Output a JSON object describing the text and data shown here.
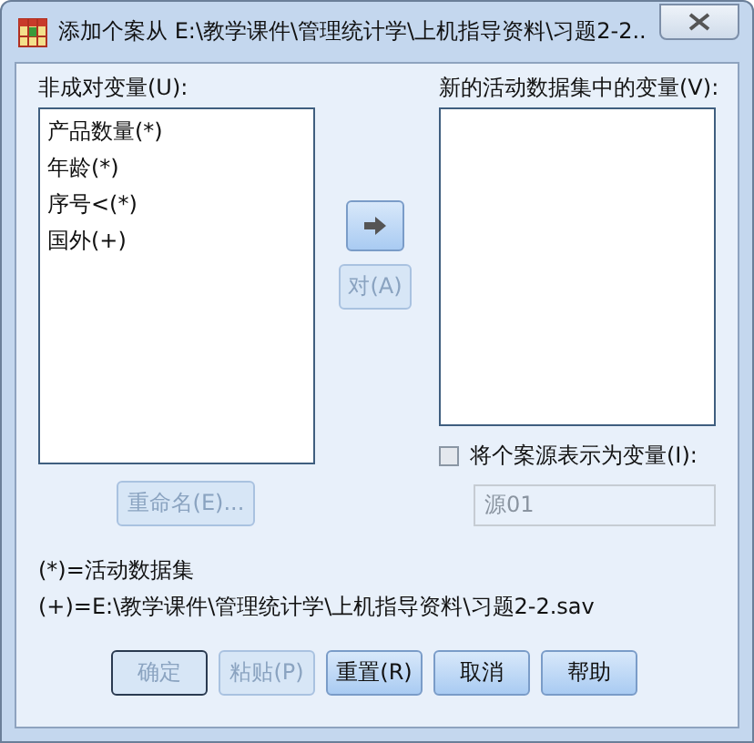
{
  "window": {
    "title": "添加个案从 E:\\教学课件\\管理统计学\\上机指导资料\\习题2-2..."
  },
  "unpaired": {
    "label": "非成对变量(U):",
    "items": [
      "产品数量(*)",
      "年龄(*)",
      "序号<(*)",
      "国外(+)"
    ]
  },
  "move_button": {
    "disabled": false
  },
  "pair_button": {
    "label": "对(A)",
    "disabled": true
  },
  "rename_button": {
    "label": "重命名(E)...",
    "disabled": true
  },
  "new_vars": {
    "label": "新的活动数据集中的变量(V):"
  },
  "source_option": {
    "label": "将个案源表示为变量(I):",
    "checked": false,
    "value": "源01",
    "disabled": true
  },
  "notes": [
    "(*)=活动数据集",
    "(+)=E:\\教学课件\\管理统计学\\上机指导资料\\习题2-2.sav"
  ],
  "buttons": [
    {
      "label": "确定",
      "disabled": true,
      "default": true
    },
    {
      "label": "粘贴(P)",
      "disabled": true,
      "default": false
    },
    {
      "label": "重置(R)",
      "disabled": false,
      "default": false
    },
    {
      "label": "取消",
      "disabled": false,
      "default": false
    },
    {
      "label": "帮助",
      "disabled": false,
      "default": false
    }
  ]
}
